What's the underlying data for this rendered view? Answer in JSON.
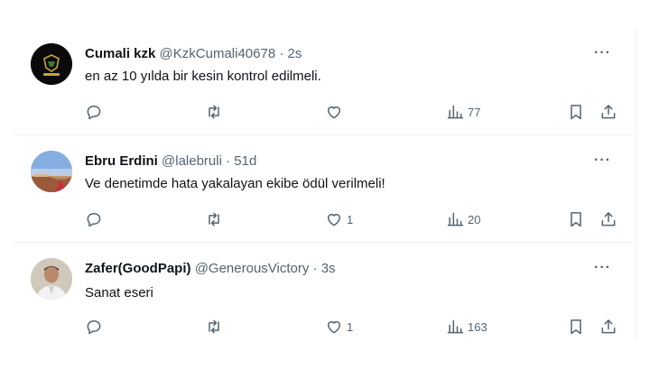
{
  "tweets": [
    {
      "name": "Cumali kzk",
      "handle": "@KzkCumali40678",
      "time": "2s",
      "text": "en az 10 yılda bir kesin kontrol edilmeli.",
      "likes": "",
      "views": "77",
      "avatar": "dark-logo-avatar"
    },
    {
      "name": "Ebru Erdini",
      "handle": "@lalebruli",
      "time": "51d",
      "text": "Ve denetimde hata yakalayan ekibe ödül verilmeli!",
      "likes": "1",
      "views": "20",
      "avatar": "landscape-avatar"
    },
    {
      "name": "Zafer(GoodPapi)",
      "handle": "@GenerousVictory",
      "time": "3s",
      "text": "Sanat eseri",
      "likes": "1",
      "views": "163",
      "avatar": "person-avatar"
    }
  ],
  "separator": "·",
  "more_label": "···",
  "icons": [
    "reply-icon",
    "retweet-icon",
    "like-icon",
    "views-icon",
    "bookmark-icon",
    "share-icon"
  ],
  "colors": {
    "text": "#0f1419",
    "secondary": "#536471",
    "divider": "#eff3f4"
  }
}
